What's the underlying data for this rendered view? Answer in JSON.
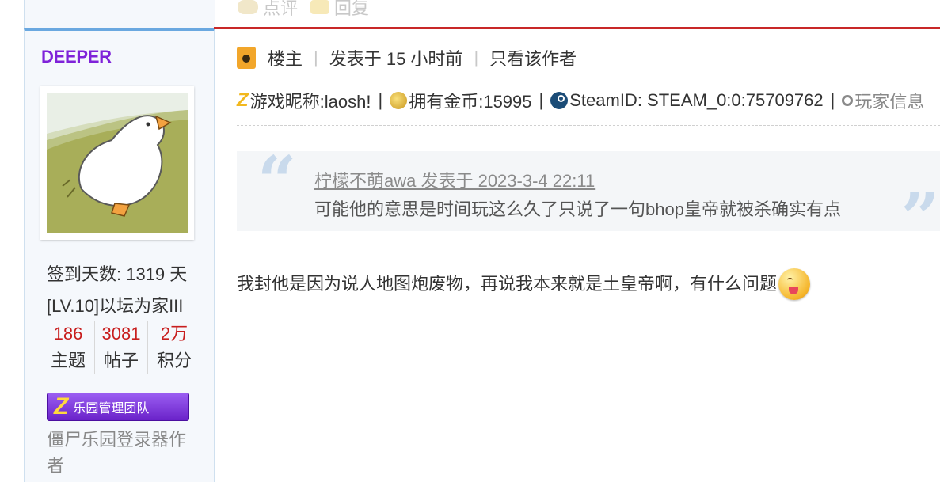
{
  "top_actions": {
    "comment_label": "点评",
    "reply_label": "回复"
  },
  "profile": {
    "username": "DEEPER",
    "checkin": "签到天数: 1319 天",
    "level": "[LV.10]以坛为家III",
    "counts": [
      {
        "num": "186",
        "label": "主题"
      },
      {
        "num": "3081",
        "label": "帖子"
      },
      {
        "num": "2万",
        "label": "积分"
      }
    ],
    "badge_label": "乐园管理团队",
    "note": "僵尸乐园登录器作者"
  },
  "post": {
    "floor": "楼主",
    "posted": "发表于 15 小时前",
    "author_only": "只看该作者",
    "info": {
      "nickname": "游戏昵称:laosh!",
      "gold": "拥有金币:15995",
      "steam": "SteamID: STEAM_0:0:75709762",
      "player_info": "玩家信息"
    },
    "quote": {
      "header": "柠檬不萌awa 发表于 2023-3-4 22:11",
      "body": "可能他的意思是时间玩这么久了只说了一句bhop皇帝就被杀确实有点"
    },
    "reply_text": "我封他是因为说人地图炮废物，再说我本来就是土皇帝啊，有什么问题"
  },
  "icons": [
    "comment-icon",
    "reply-icon",
    "floor-icon",
    "z-icon",
    "coin-icon",
    "steam-icon",
    "search-icon",
    "smile-emoji-icon"
  ]
}
